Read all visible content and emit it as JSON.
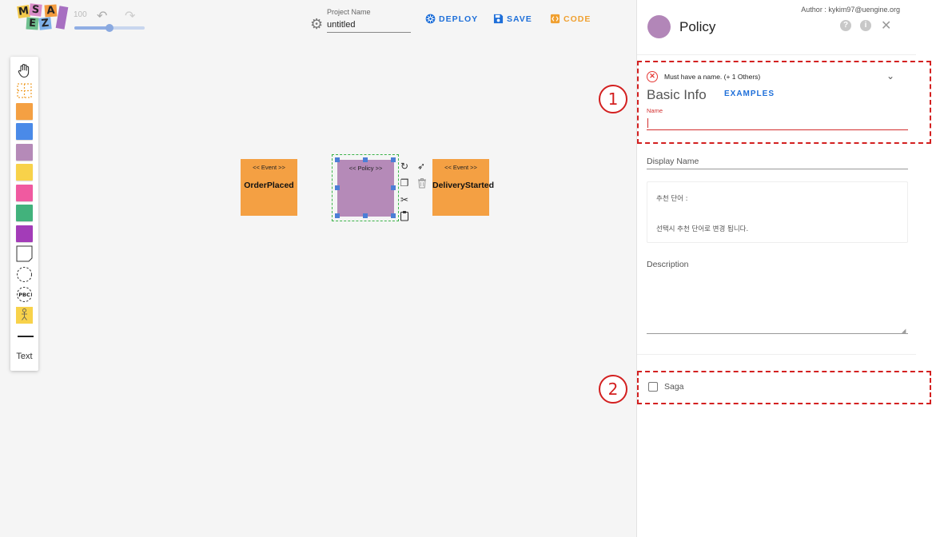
{
  "logo": {
    "letters": [
      "M",
      "S",
      "A",
      "E",
      "Z"
    ]
  },
  "toolbar": {
    "zoom_value": "100",
    "zoom_fraction": 0.5,
    "undo_icon": "undo-icon",
    "redo_icon": "redo-icon",
    "project_label": "Project Name",
    "project_value": "untitled",
    "deploy_label": "DEPLOY",
    "save_label": "SAVE",
    "code_label": "CODE"
  },
  "palette": {
    "items": [
      {
        "name": "hand-tool-icon",
        "kind": "hand"
      },
      {
        "name": "select-tool-icon",
        "kind": "select"
      },
      {
        "name": "event-sticker",
        "kind": "sticky",
        "color": "#f4a043"
      },
      {
        "name": "command-sticker",
        "kind": "sticky",
        "color": "#4a8ae8"
      },
      {
        "name": "policy-sticker",
        "kind": "sticky",
        "color": "#b58ab8"
      },
      {
        "name": "aggregate-sticker",
        "kind": "sticky",
        "color": "#f8d24a"
      },
      {
        "name": "external-sticker",
        "kind": "sticky",
        "color": "#f05aa0"
      },
      {
        "name": "readmodel-sticker",
        "kind": "sticky",
        "color": "#42b27c"
      },
      {
        "name": "issue-sticker",
        "kind": "sticky",
        "color": "#a33cb8"
      },
      {
        "name": "ui-sticker",
        "kind": "outline"
      },
      {
        "name": "bounded-context-icon",
        "kind": "dashed-circle"
      },
      {
        "name": "pbc-icon",
        "kind": "pbc"
      },
      {
        "name": "actor-sticker",
        "kind": "actor",
        "color": "#f8d24a"
      }
    ],
    "line_label": "line-tool",
    "text_label": "Text"
  },
  "canvas": {
    "nodes": [
      {
        "id": "orderplaced",
        "stereo": "<< Event >>",
        "name": "OrderPlaced",
        "color": "#f4a043"
      },
      {
        "id": "policy",
        "stereo": "<< Policy >>",
        "name": "",
        "color": "#b58ab8"
      },
      {
        "id": "deliverystarted",
        "stereo": "<< Event >>",
        "name": "DeliveryStarted",
        "color": "#f4a043"
      }
    ]
  },
  "panel": {
    "author": "Author : kykim97@uengine.org",
    "title": "Policy",
    "error_text": "Must have a name. (+ 1 Others)",
    "basic_info": "Basic Info",
    "examples_label": "EXAMPLES",
    "name_label": "Name",
    "name_value": "",
    "display_name_label": "Display Name",
    "suggest_line1": "추천 단어 :",
    "suggest_line2": "선택시 추천 단어로 변경 됩니다.",
    "description_label": "Description",
    "saga_label": "Saga",
    "saga_checked": false
  },
  "annotations": {
    "callout1": "1",
    "callout2": "2"
  }
}
